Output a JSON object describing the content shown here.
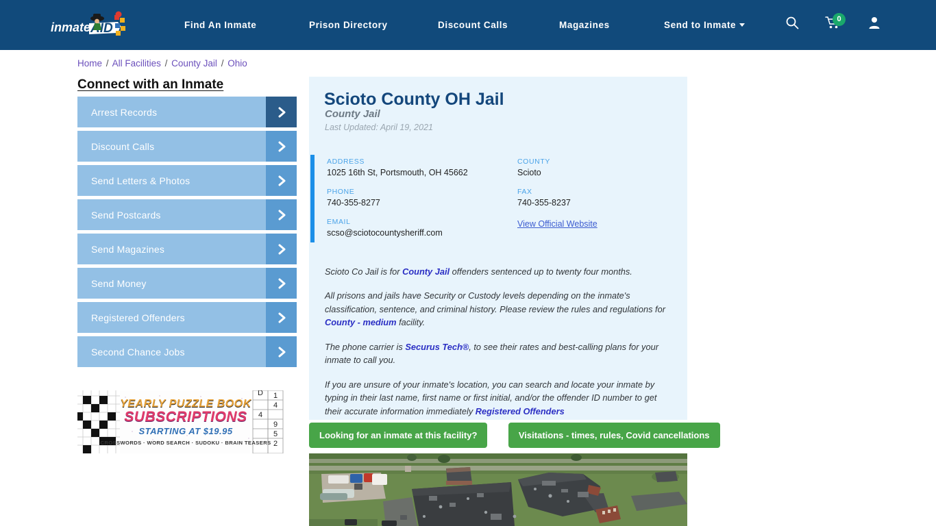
{
  "header": {
    "logo_text": "inmateAID",
    "nav": [
      {
        "label": "Find An Inmate",
        "icon": ""
      },
      {
        "label": "Prison Directory",
        "icon": ""
      },
      {
        "label": "Discount Calls",
        "icon": ""
      },
      {
        "label": "Magazines",
        "icon": ""
      },
      {
        "label": "Send to Inmate",
        "icon": "chevron-down-icon"
      }
    ],
    "icons": {
      "search": "search-icon",
      "cart": "cart-icon",
      "account": "user-icon"
    },
    "cart_count": "0",
    "cart_badge_color": "#1aa86b",
    "bar_color": "#114a7b"
  },
  "breadcrumb": {
    "items": [
      "Home",
      "All Facilities",
      "County Jail",
      "Ohio"
    ],
    "separator": "/"
  },
  "sidebar": {
    "title": "Connect with an Inmate",
    "items": [
      {
        "label": "Arrest Records",
        "active": true
      },
      {
        "label": "Discount Calls",
        "active": false
      },
      {
        "label": "Send Letters & Photos",
        "active": false
      },
      {
        "label": "Send Postcards",
        "active": false
      },
      {
        "label": "Send Magazines",
        "active": false
      },
      {
        "label": "Send Money",
        "active": false
      },
      {
        "label": "Registered Offenders",
        "active": false
      },
      {
        "label": "Second Chance Jobs",
        "active": false
      }
    ],
    "item_color": "#93c0e5",
    "chevron_color": "#5a9bd1",
    "chevron_active_color": "#2b5c8a"
  },
  "ad": {
    "line1": "YEARLY PUZZLE BOOK",
    "line2": "SUBSCRIPTIONS",
    "line3": "STARTING AT $19.95",
    "line4": "CROSSWORDS · WORD SEARCH · SUDOKU · BRAIN TEASERS"
  },
  "facility": {
    "name": "Scioto County OH Jail",
    "type": "County Jail",
    "last_updated": "Last Updated: April 19, 2021",
    "contact": {
      "address_label": "ADDRESS",
      "address_value": "1025 16th St, Portsmouth, OH 45662",
      "phone_label": "PHONE",
      "phone_value": "740-355-8277",
      "email_label": "EMAIL",
      "email_value": "scso@sciotocountysheriff.com",
      "county_label": "COUNTY",
      "county_value": "Scioto",
      "fax_label": "FAX",
      "fax_value": "740-355-8237",
      "website_link": "View Official Website"
    },
    "paragraphs": {
      "p1_a": "Scioto Co Jail is for ",
      "p1_link": "County Jail",
      "p1_b": " offenders sentenced up to twenty four months.",
      "p2_a": "All prisons and jails have Security or Custody levels depending on the inmate's classification, sentence, and criminal history. Please review the rules and regulations for ",
      "p2_link": "County - medium",
      "p2_b": " facility.",
      "p3_a": "The phone carrier is ",
      "p3_link": "Securus Tech®",
      "p3_b": ", to see their rates and best-calling plans for your inmate to call you.",
      "p4_a": "If you are unsure of your inmate's location, you can search and locate your inmate by typing in their last name, first name or first initial, and/or the offender ID number to get their accurate information immediately ",
      "p4_link": "Registered Offenders"
    },
    "panel_bg": "#e8f4fc",
    "accent_color": "#1c8fe8"
  },
  "actions": {
    "find_inmate": "Looking for an inmate at this facility?",
    "visitations": "Visitations - times, rules, Covid cancellations",
    "button_color": "#48a548"
  },
  "photo": {
    "alt": "aerial-photo-of-jail-facility"
  }
}
